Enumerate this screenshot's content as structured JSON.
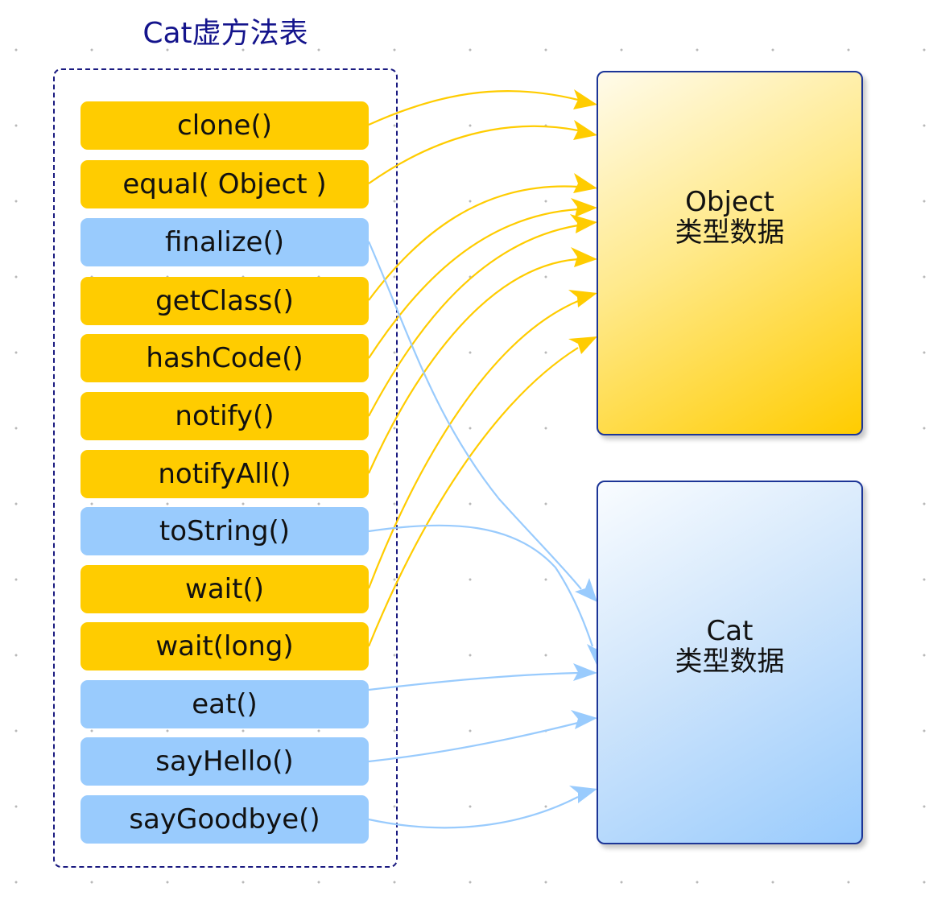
{
  "vtable": {
    "title": "Cat虚方法表",
    "methods": [
      {
        "label": "clone()",
        "owner": "Object"
      },
      {
        "label": "equal( Object )",
        "owner": "Object"
      },
      {
        "label": "finalize()",
        "owner": "Cat"
      },
      {
        "label": "getClass()",
        "owner": "Object"
      },
      {
        "label": "hashCode()",
        "owner": "Object"
      },
      {
        "label": "notify()",
        "owner": "Object"
      },
      {
        "label": "notifyAll()",
        "owner": "Object"
      },
      {
        "label": "toString()",
        "owner": "Cat"
      },
      {
        "label": "wait()",
        "owner": "Object"
      },
      {
        "label": "wait(long)",
        "owner": "Object"
      },
      {
        "label": "eat()",
        "owner": "Cat"
      },
      {
        "label": "sayHello()",
        "owner": "Cat"
      },
      {
        "label": "sayGoodbye()",
        "owner": "Cat"
      }
    ]
  },
  "targets": {
    "object": {
      "line1": "Object",
      "line2": "类型数据"
    },
    "cat": {
      "line1": "Cat",
      "line2": "类型数据"
    }
  },
  "colors": {
    "object_accent": "#ffcc00",
    "cat_accent": "#99cbfd",
    "title": "#14148c",
    "border": "#1c3597"
  }
}
